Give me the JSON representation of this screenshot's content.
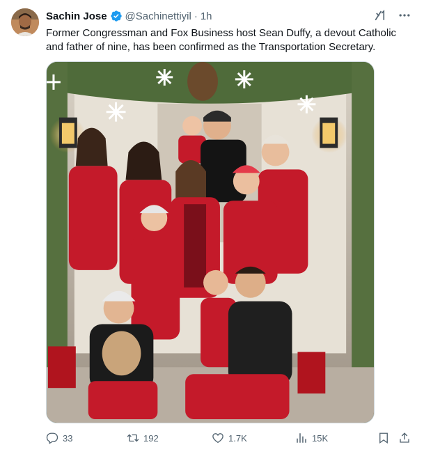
{
  "author": {
    "display_name": "Sachin Jose",
    "handle": "@Sachinettiyil",
    "separator": "·",
    "time": "1h"
  },
  "tweet": {
    "text": "Former Congressman and Fox Business host Sean Duffy, a devout Catholic and father of nine, has been confirmed as the Transportation Secretary."
  },
  "stats": {
    "replies": "33",
    "retweets": "192",
    "likes": "1.7K",
    "views": "15K"
  },
  "colors": {
    "verified": "#1d9bf0",
    "text_secondary": "#536471",
    "pajama_red": "#c41a2a"
  },
  "icons": [
    "verified-badge-icon",
    "grok-icon",
    "more-icon",
    "reply-icon",
    "retweet-icon",
    "like-icon",
    "views-icon",
    "bookmark-icon",
    "share-icon"
  ]
}
